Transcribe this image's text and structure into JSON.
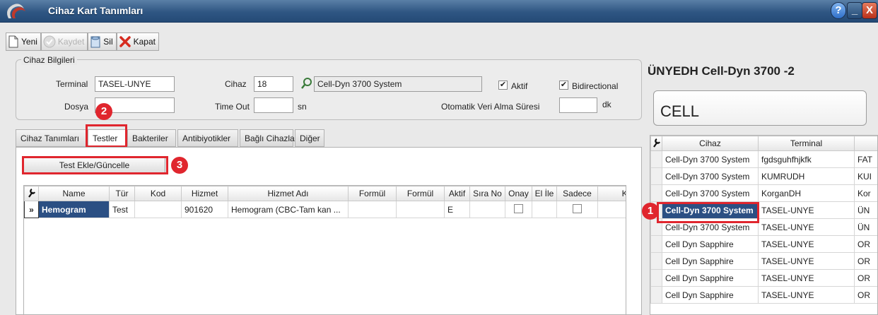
{
  "window": {
    "title": "Cihaz Kart Tanımları",
    "controls": {
      "help": "?",
      "minimize": "_",
      "close": "X"
    }
  },
  "toolbar": {
    "new_label": "Yeni",
    "save_label": "Kaydet",
    "delete_label": "Sil",
    "close_label": "Kapat"
  },
  "device_info": {
    "group_title": "Cihaz Bilgileri",
    "terminal_label": "Terminal",
    "terminal_value": "TASEL-UNYE",
    "file_label": "Dosya",
    "file_value": "",
    "device_label": "Cihaz",
    "device_id": "18",
    "device_name": "Cell-Dyn 3700 System",
    "timeout_label": "Time Out",
    "timeout_value": "",
    "timeout_unit": "sn",
    "active_label": "Aktif",
    "active_checked": true,
    "bidirectional_label": "Bidirectional",
    "bidirectional_checked": true,
    "auto_fetch_label": "Otomatik Veri Alma Süresi",
    "auto_fetch_value": "",
    "auto_fetch_unit": "dk"
  },
  "tabs": [
    {
      "label": "Cihaz Tanımları",
      "active": false
    },
    {
      "label": "Testler",
      "active": true
    },
    {
      "label": "Bakteriler",
      "active": false
    },
    {
      "label": "Antibiyotikler",
      "active": false
    },
    {
      "label": "Bağlı Cihazlar",
      "active": false
    },
    {
      "label": "Diğer",
      "active": false
    }
  ],
  "tests_tab": {
    "add_button_label": "Test Ekle/Güncelle",
    "columns": [
      "Name",
      "Tür",
      "Kod",
      "Hizmet",
      "Hizmet Adı",
      "Formül",
      "Formül",
      "Aktif",
      "Sıra No",
      "Onay",
      "El İle",
      "Sadece",
      "Kay"
    ],
    "rows": [
      {
        "indicator": "»",
        "name": "Hemogram",
        "tur": "Test",
        "kod": "",
        "hizmet": "901620",
        "hizmet_adi": "Hemogram (CBC-Tam kan ...",
        "formul1": "",
        "formul2": "",
        "aktif": "E",
        "sira_no": "",
        "onay": false,
        "el_ile": "",
        "sadece": false,
        "kay": ""
      }
    ]
  },
  "right_panel": {
    "title": "ÜNYEDH Cell-Dyn 3700 -2",
    "search_text": "CELL",
    "columns": [
      "Cihaz",
      "Terminal",
      ""
    ],
    "rows": [
      {
        "cihaz": "Cell-Dyn 3700 System",
        "terminal": "fgdsguhfhjkfk",
        "extra": "FAT"
      },
      {
        "cihaz": "Cell-Dyn 3700 System",
        "terminal": "KUMRUDH",
        "extra": "KUI"
      },
      {
        "cihaz": "Cell-Dyn 3700 System",
        "terminal": "KorganDH",
        "extra": "Kor"
      },
      {
        "cihaz": "Cell-Dyn 3700 System",
        "terminal": "TASEL-UNYE",
        "extra": "ÜN"
      },
      {
        "cihaz": "Cell-Dyn 3700 System",
        "terminal": "TASEL-UNYE",
        "extra": "ÜN"
      },
      {
        "cihaz": "Cell Dyn Sapphire",
        "terminal": "TASEL-UNYE",
        "extra": "OR"
      },
      {
        "cihaz": "Cell Dyn Sapphire",
        "terminal": "TASEL-UNYE",
        "extra": "OR"
      },
      {
        "cihaz": "Cell Dyn Sapphire",
        "terminal": "TASEL-UNYE",
        "extra": "OR"
      },
      {
        "cihaz": "Cell Dyn Sapphire",
        "terminal": "TASEL-UNYE",
        "extra": "OR"
      }
    ],
    "selected_row": 3
  },
  "annotations": {
    "step1": "1",
    "step2": "2",
    "step3": "3"
  },
  "colors": {
    "accent": "#e0262e",
    "selection": "#2b4f83",
    "titlebar": "#2f5683"
  },
  "icons": {
    "new": "document-icon",
    "save": "save-disk-icon",
    "delete": "trash-icon",
    "close": "red-x-icon",
    "lookup": "magnifier-icon",
    "grid_settings": "wrench-icon",
    "row_indicator": "double-chevron-icon"
  }
}
